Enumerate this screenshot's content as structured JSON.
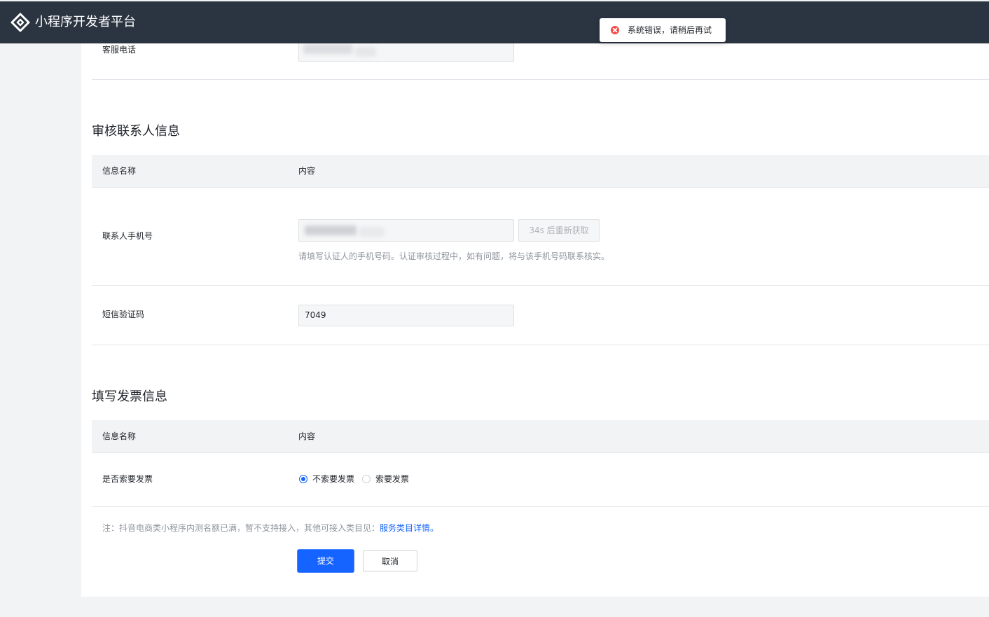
{
  "header": {
    "brand": "小程序开发者平台"
  },
  "toast": {
    "message": "系统错误，请稍后再试",
    "icon": "error-circle-icon",
    "color": "#f54a45"
  },
  "service_phone": {
    "label": "客服电话"
  },
  "review_contact": {
    "title": "审核联系人信息",
    "col_name": "信息名称",
    "col_content": "内容",
    "phone_label": "联系人手机号",
    "resend_label": "34s 后重新获取",
    "phone_hint": "请填写认证人的手机号码。认证审核过程中，如有问题，将与该手机号码联系核实。",
    "sms_label": "短信验证码",
    "sms_value": "7049"
  },
  "invoice": {
    "title": "填写发票信息",
    "col_name": "信息名称",
    "col_content": "内容",
    "need_label": "是否索要发票",
    "option_no": "不索要发票",
    "option_yes": "索要发票",
    "selected": "不索要发票"
  },
  "note": {
    "text": "注：抖音电商类小程序内测名额已满，暂不支持接入，其他可接入类目见：",
    "link": "服务类目详情。"
  },
  "actions": {
    "submit": "提交",
    "cancel": "取消"
  },
  "colors": {
    "topbar": "#2b3441",
    "primary": "#1664ff"
  }
}
